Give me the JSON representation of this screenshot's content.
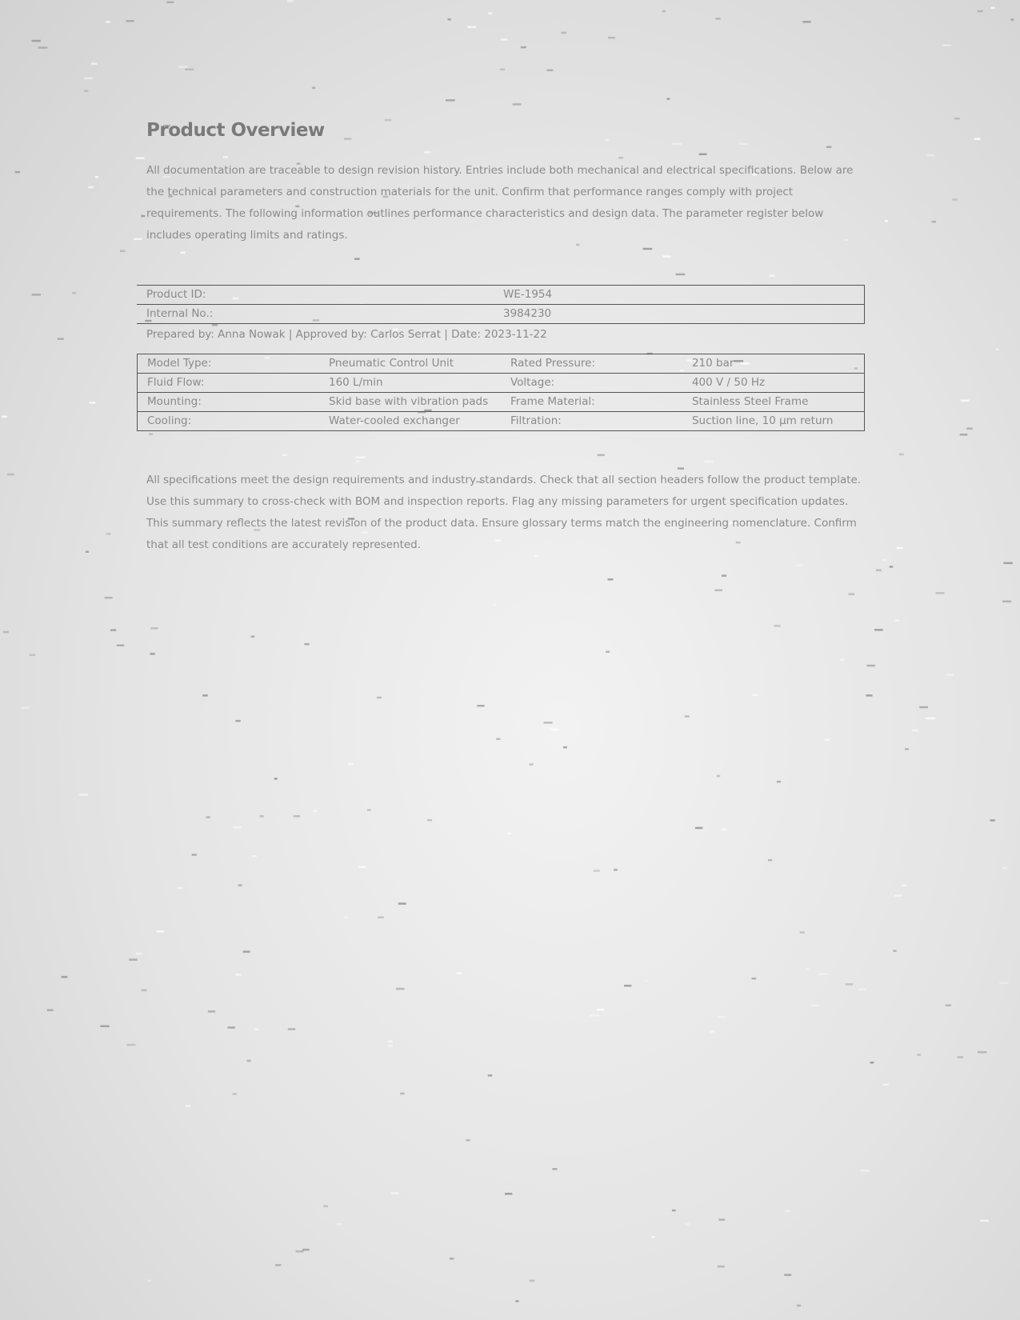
{
  "document": {
    "title": "Product Overview",
    "intro": "All documentation are traceable to design revision history. Entries include both mechanical and electrical specifications. Below are the technical parameters and construction materials for the unit. Confirm that performance ranges comply with project requirements. The following information outlines performance characteristics and design data. The parameter register below includes operating limits and ratings.",
    "id_table": {
      "rows": [
        [
          "Product ID:",
          "WE-1954"
        ],
        [
          "Internal No.:",
          "3984230"
        ]
      ]
    },
    "prepared_line": "Prepared by: Anna Nowak | Approved by: Carlos Serrat | Date: 2023-11-22",
    "spec_table": {
      "rows": [
        [
          "Model Type:",
          "Pneumatic Control Unit",
          "Rated Pressure:",
          "210 bar"
        ],
        [
          "Fluid Flow:",
          "160 L/min",
          "Voltage:",
          "400 V / 50 Hz"
        ],
        [
          "Mounting:",
          "Skid base with vibration pads",
          "Frame Material:",
          "Stainless Steel Frame"
        ],
        [
          "Cooling:",
          "Water-cooled exchanger",
          "Filtration:",
          "Suction line, 10 µm return"
        ]
      ]
    },
    "closing": "All specifications meet the design requirements and industry standards. Check that all section headers follow the product template. Use this summary to cross-check with BOM and inspection reports. Flag any missing parameters for urgent specification updates. This summary reflects the latest revision of the product data. Ensure glossary terms match the engineering nomenclature. Confirm that all test conditions are accurately represented."
  }
}
